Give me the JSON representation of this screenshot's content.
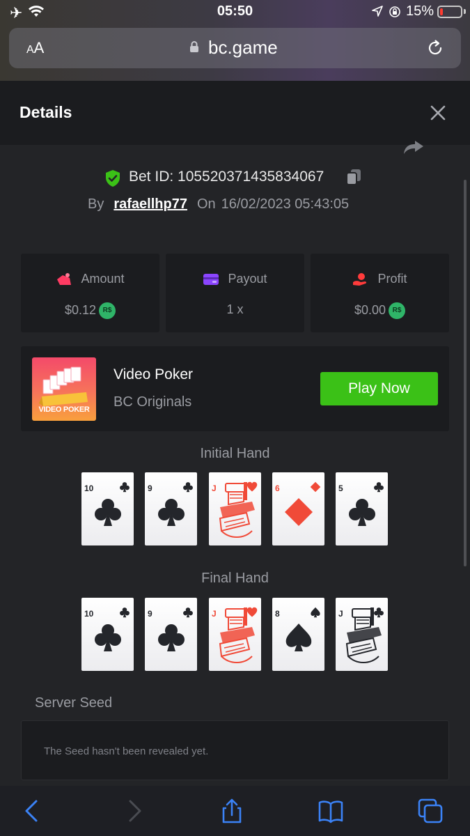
{
  "status": {
    "time": "05:50",
    "battery_pct": "15%",
    "battery_level": 0.15,
    "battery_color": "#ff3b30"
  },
  "browser": {
    "aa_label": "AA",
    "url": "bc.game"
  },
  "modal": {
    "title": "Details"
  },
  "bet": {
    "id_label": "Bet ID: 105520371435834067",
    "by_label": "By",
    "user": "rafaellhp77",
    "on_label": "On",
    "datetime": "16/02/2023 05:43:05"
  },
  "stats": [
    {
      "label": "Amount",
      "value": "$0.12",
      "icon": "amount-icon",
      "color": "#ff3b63"
    },
    {
      "label": "Payout",
      "value": "1 x",
      "icon": "payout-icon",
      "color": "#8b45ff"
    },
    {
      "label": "Profit",
      "value": "$0.00",
      "icon": "profit-icon",
      "color": "#ff3b3b"
    }
  ],
  "currency_badge": "R$",
  "game": {
    "thumb_label": "VIDEO POKER",
    "name": "Video Poker",
    "provider": "BC Originals",
    "play_label": "Play Now",
    "play_color": "#3bc117"
  },
  "initial_hand": {
    "label": "Initial Hand",
    "cards": [
      {
        "rank": "10",
        "suit": "clubs"
      },
      {
        "rank": "9",
        "suit": "clubs"
      },
      {
        "rank": "J",
        "suit": "hearts"
      },
      {
        "rank": "6",
        "suit": "diamonds"
      },
      {
        "rank": "5",
        "suit": "clubs"
      }
    ]
  },
  "final_hand": {
    "label": "Final Hand",
    "cards": [
      {
        "rank": "10",
        "suit": "clubs"
      },
      {
        "rank": "9",
        "suit": "clubs"
      },
      {
        "rank": "J",
        "suit": "hearts"
      },
      {
        "rank": "8",
        "suit": "spades"
      },
      {
        "rank": "J",
        "suit": "clubs"
      }
    ]
  },
  "server_seed": {
    "label": "Server Seed",
    "text": "The Seed hasn't been revealed yet."
  },
  "colors": {
    "red_suit": "#f04a38",
    "black_suit": "#24262b"
  }
}
